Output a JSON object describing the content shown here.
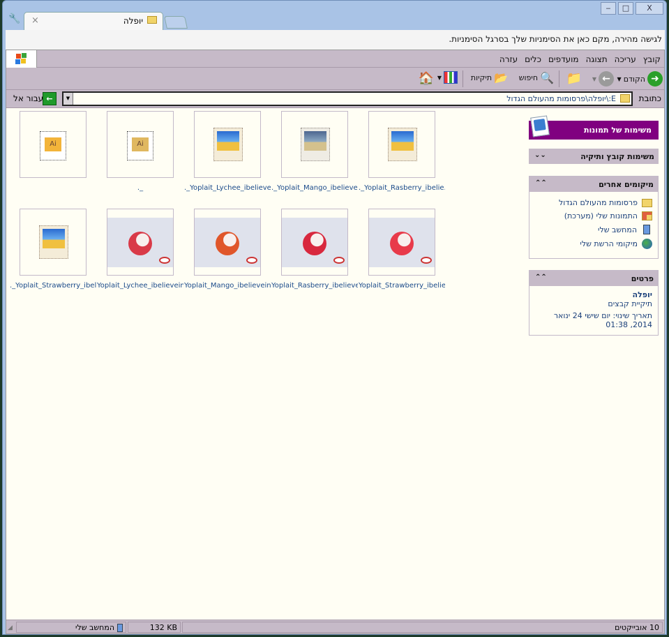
{
  "window": {
    "minimize": "‒",
    "maximize": "□",
    "close": "X"
  },
  "tab": {
    "title": "יופלה",
    "close": "×"
  },
  "bookmarks_bar": {
    "text": "לגישה מהירה, מקם כאן את הסימניות שלך בסרגל הסימניות."
  },
  "menu": [
    "קובץ",
    "עריכה",
    "תצוגה",
    "מועדפים",
    "כלים",
    "עזרה"
  ],
  "toolbar": {
    "back": "הקודם",
    "search": "חיפוש",
    "folders": "תיקיות"
  },
  "address": {
    "label": "כתובת",
    "value": "E:\\יופלה\\פרסומות מהעולם הגדול",
    "go": "עבור אל"
  },
  "files": [
    {
      "name": "._Yoplait_Rasberry_ibelie...",
      "type": "image-placeholder"
    },
    {
      "name": "._Yoplait_Mango_ibelievei...",
      "type": "image-placeholder-gray"
    },
    {
      "name": "._Yoplait_Lychee_ibelievei...",
      "type": "image-placeholder"
    },
    {
      "name": "._",
      "type": "ai-gray"
    },
    {
      "name": "",
      "type": "ai"
    },
    {
      "name": "Yoplait_Strawberry_ibelie...",
      "type": "photo",
      "fruit": "#e83a4a"
    },
    {
      "name": "Yoplait_Rasberry_ibelievei...",
      "type": "photo",
      "fruit": "#d8283e"
    },
    {
      "name": "Yoplait_Mango_ibelieveina...",
      "type": "photo",
      "fruit": "#e0562a"
    },
    {
      "name": "Yoplait_Lychee_ibelievein...",
      "type": "photo",
      "fruit": "#d93a48"
    },
    {
      "name": "._Yoplait_Strawberry_ibeli...",
      "type": "image-placeholder"
    }
  ],
  "sidebar": {
    "picture_tasks": "משימות של תמונות",
    "file_tasks": "משימות קובץ ותיקיה",
    "other_places": {
      "title": "מיקומים אחרים",
      "items": [
        {
          "label": "פרסומות מהעולם הגדול",
          "icon": "folder-icon"
        },
        {
          "label": "התמונות שלי (מערכת)",
          "icon": "pictures-folder-icon"
        },
        {
          "label": "המחשב שלי",
          "icon": "computer-icon"
        },
        {
          "label": "מיקומי הרשת שלי",
          "icon": "network-icon"
        }
      ]
    },
    "details": {
      "title": "פרטים",
      "name": "יופלה",
      "type": "תיקיית קבצים",
      "modified": "תאריך שינוי: יום שישי 24 ינואר 2014, 01:38"
    }
  },
  "status": {
    "objects": "10 אובייקטים",
    "size": "132 KB",
    "location": "המחשב שלי"
  },
  "colors": {
    "menu_bg": "#c6bac8",
    "content_bg": "#fffef4",
    "panel_title": "#800080",
    "link": "#1a3f7a"
  }
}
